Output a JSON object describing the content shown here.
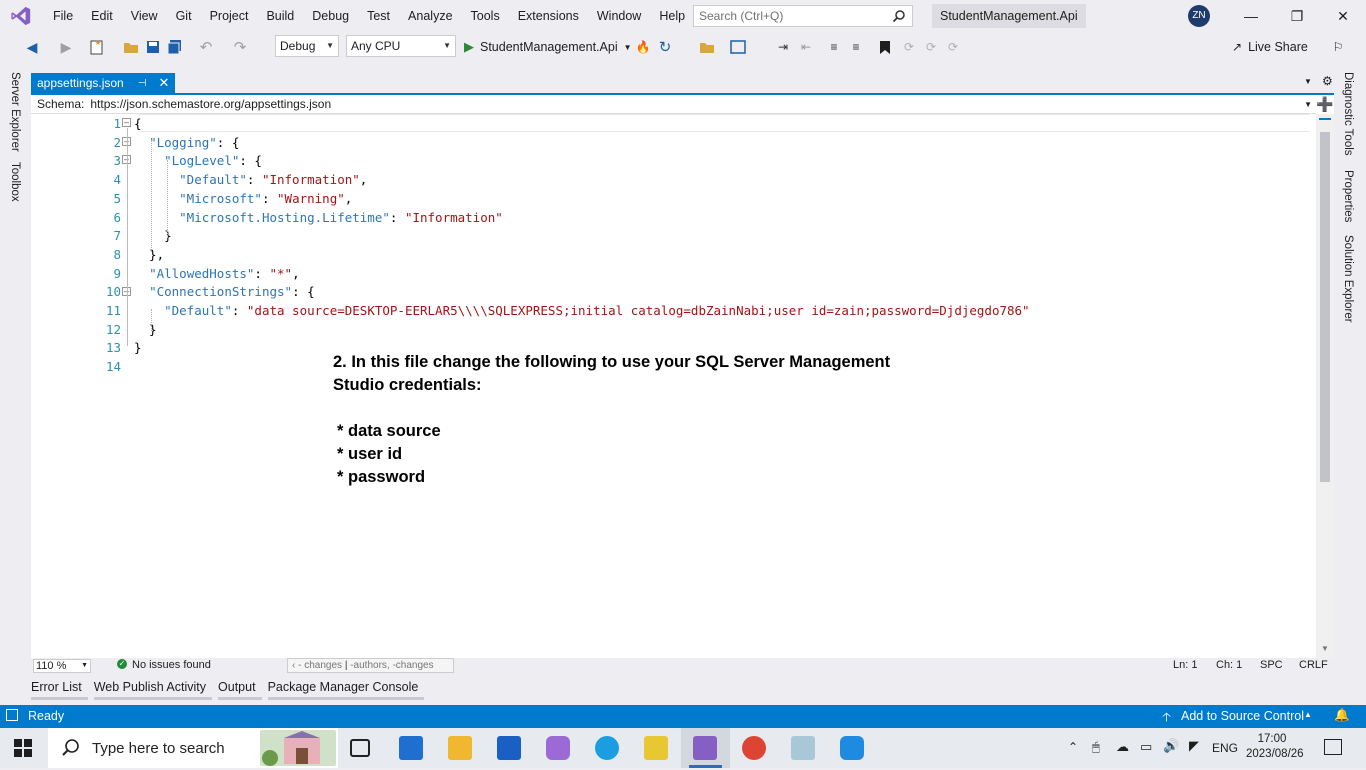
{
  "menubar": {
    "items": [
      "File",
      "Edit",
      "View",
      "Git",
      "Project",
      "Build",
      "Debug",
      "Test",
      "Analyze",
      "Tools",
      "Extensions",
      "Window",
      "Help"
    ],
    "search_placeholder": "Search (Ctrl+Q)",
    "solution_title": "StudentManagement.Api",
    "avatar_initials": "ZN"
  },
  "toolbar": {
    "configuration": "Debug",
    "platform": "Any CPU",
    "startup_project": "StudentManagement.Api",
    "live_share": "Live Share"
  },
  "side_left": [
    "Server Explorer",
    "Toolbox"
  ],
  "side_right": [
    "Diagnostic Tools",
    "Properties",
    "Solution Explorer"
  ],
  "document": {
    "tab_title": "appsettings.json",
    "schema_label": "Schema:",
    "schema_url": "https://json.schemastore.org/appsettings.json"
  },
  "code_lines": [
    {
      "n": "1",
      "html": "{"
    },
    {
      "n": "2",
      "html": "  <span class='k'>\"Logging\"</span>: {"
    },
    {
      "n": "3",
      "html": "    <span class='k'>\"LogLevel\"</span>: {"
    },
    {
      "n": "4",
      "html": "      <span class='k'>\"Default\"</span>: <span class='s'>\"Information\"</span>,"
    },
    {
      "n": "5",
      "html": "      <span class='k'>\"Microsoft\"</span>: <span class='s'>\"Warning\"</span>,"
    },
    {
      "n": "6",
      "html": "      <span class='k'>\"Microsoft.Hosting.Lifetime\"</span>: <span class='s'>\"Information\"</span>"
    },
    {
      "n": "7",
      "html": "    }"
    },
    {
      "n": "8",
      "html": "  },"
    },
    {
      "n": "9",
      "html": "  <span class='k'>\"AllowedHosts\"</span>: <span class='s'>\"*\"</span>,"
    },
    {
      "n": "10",
      "html": "  <span class='k'>\"ConnectionStrings\"</span>: {"
    },
    {
      "n": "11",
      "html": "    <span class='k'>\"Default\"</span>: <span class='s'>\"data source=DESKTOP-EERLAR5\\\\\\\\SQLEXPRESS;initial catalog=dbZainNabi;user id=zain;password=Djdjegdo786\"</span>"
    },
    {
      "n": "12",
      "html": "  }"
    },
    {
      "n": "13",
      "html": "}"
    },
    {
      "n": "14",
      "html": ""
    }
  ],
  "annotation": {
    "line1": "2. In this file change the following to use your SQL Server Management",
    "line2": "Studio credentials:",
    "bullets": [
      "*  data source",
      "*  user id",
      "*  password"
    ]
  },
  "editor_status": {
    "zoom": "110 %",
    "issues": "No issues found",
    "changes": "- changes",
    "authors": "-authors, -changes",
    "ln": "Ln: 1",
    "ch": "Ch: 1",
    "spc": "SPC",
    "crlf": "CRLF"
  },
  "bottom_tabs": [
    "Error List",
    "Web Publish Activity",
    "Output",
    "Package Manager Console"
  ],
  "statusbar": {
    "ready": "Ready",
    "source_control": "Add to Source Control"
  },
  "taskbar": {
    "search_placeholder": "Type here to search",
    "language": "ENG",
    "time": "17:00",
    "date": "2023/08/26"
  },
  "colors": {
    "accent": "#007acc",
    "keyword": "#2e75b6",
    "string": "#a31515",
    "line_number": "#2b91af"
  }
}
